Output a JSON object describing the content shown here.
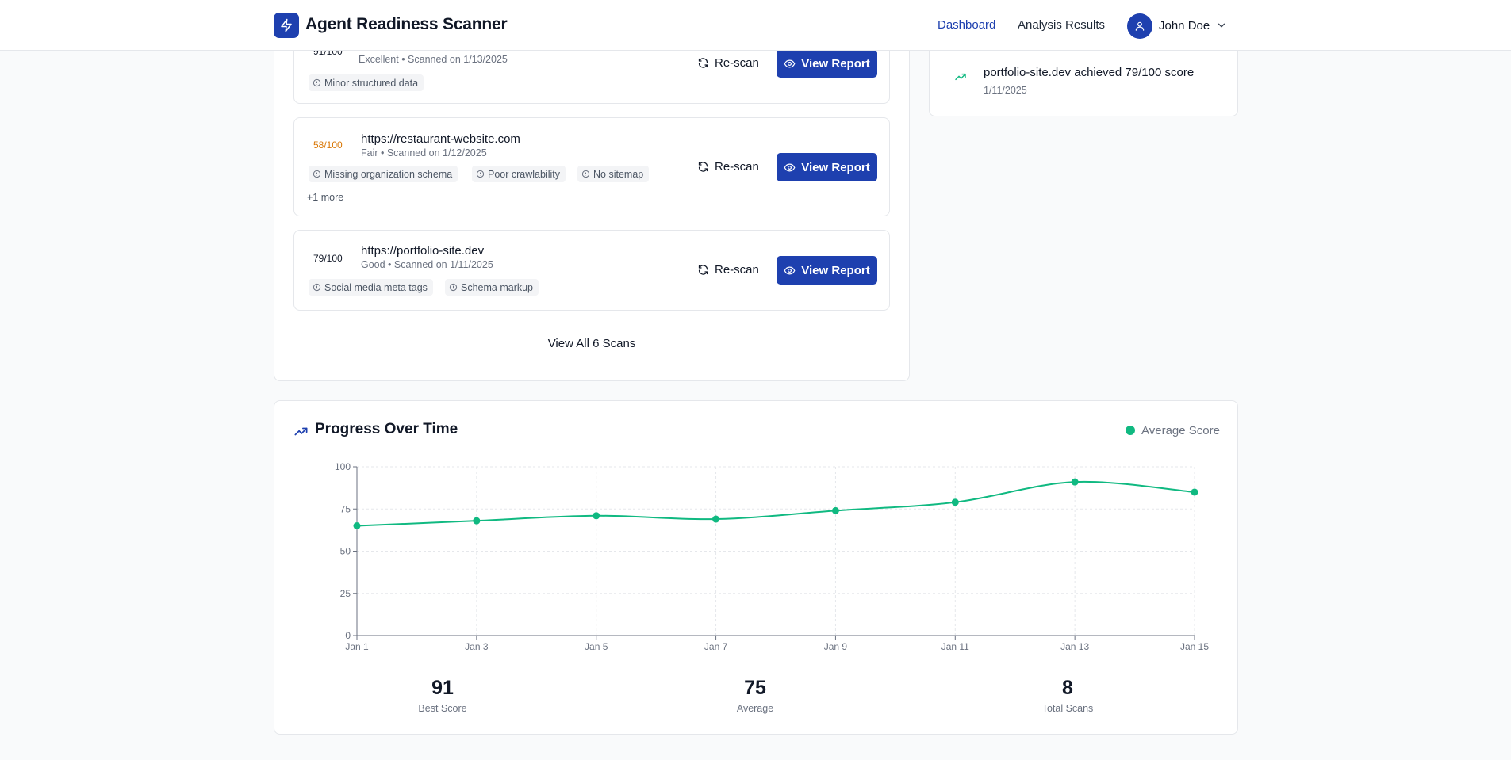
{
  "header": {
    "app_title": "Agent Readiness Scanner",
    "nav": [
      {
        "label": "Dashboard",
        "active": true
      },
      {
        "label": "Analysis Results",
        "active": false
      }
    ],
    "user": {
      "name": "John Doe"
    }
  },
  "scans": [
    {
      "score": "91/100",
      "score_color": "#16a34a",
      "url": "",
      "meta": "Excellent • Scanned on 1/13/2025",
      "tags": [
        "Minor structured data"
      ],
      "more": "",
      "rescan_label": "Re-scan",
      "view_label": "View Report"
    },
    {
      "score": "58/100",
      "score_color": "#d97706",
      "url": "https://restaurant-website.com",
      "meta": "Fair • Scanned on 1/12/2025",
      "tags": [
        "Missing organization schema",
        "Poor crawlability",
        "No sitemap"
      ],
      "more": "+1 more",
      "rescan_label": "Re-scan",
      "view_label": "View Report"
    },
    {
      "score": "79/100",
      "score_color": "#16a34a",
      "url": "https://portfolio-site.dev",
      "meta": "Good • Scanned on 1/11/2025",
      "tags": [
        "Social media meta tags",
        "Schema markup"
      ],
      "more": "",
      "rescan_label": "Re-scan",
      "view_label": "View Report"
    }
  ],
  "view_all_label": "View All 6 Scans",
  "activity": {
    "text": "portfolio-site.dev achieved 79/100 score",
    "date": "1/11/2025",
    "icon": "trending-up-icon",
    "icon_color": "#10b981"
  },
  "progress": {
    "title": "Progress Over Time",
    "legend_label": "Average Score",
    "accent": "#10b981"
  },
  "chart_data": {
    "type": "line",
    "x": [
      "Jan 1",
      "Jan 3",
      "Jan 5",
      "Jan 7",
      "Jan 9",
      "Jan 11",
      "Jan 13",
      "Jan 15"
    ],
    "series": [
      {
        "name": "Average Score",
        "values": [
          65,
          68,
          71,
          69,
          74,
          79,
          91,
          85
        ]
      }
    ],
    "yticks": [
      0,
      25,
      50,
      75,
      100
    ],
    "ylim": [
      0,
      100
    ],
    "grid": true,
    "legend": "top-right",
    "color": "#10b981"
  },
  "stats": [
    {
      "value": "91",
      "label": "Best Score"
    },
    {
      "value": "75",
      "label": "Average"
    },
    {
      "value": "8",
      "label": "Total Scans"
    }
  ]
}
